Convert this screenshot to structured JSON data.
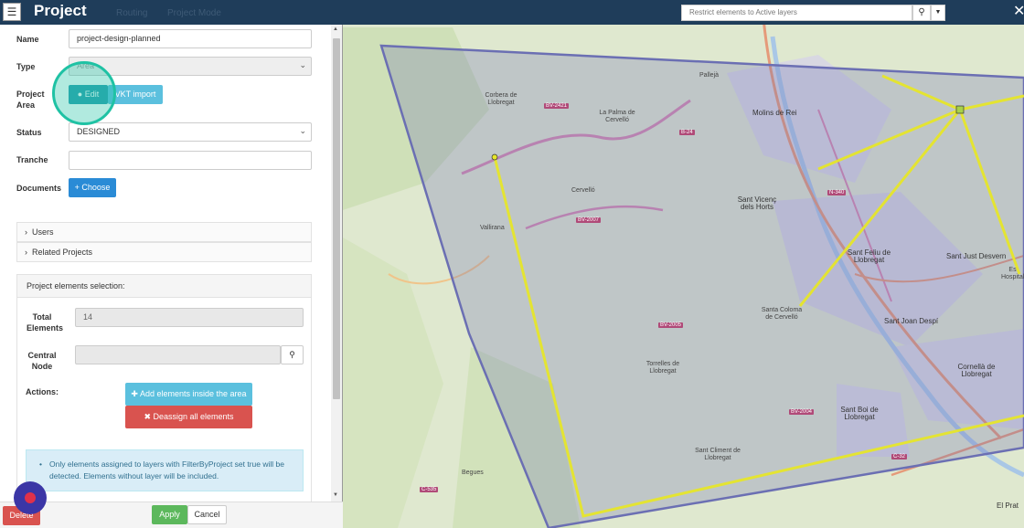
{
  "panel": {
    "title": "Project",
    "ghost_tabs": [
      "Routing",
      "Project Mode"
    ],
    "fields": {
      "name_label": "Name",
      "name_value": "project-design-planned",
      "type_label": "Type",
      "type_value": "Area",
      "area_label_1": "Project",
      "area_label_2": "Area",
      "edit_label": "Edit",
      "import_label": "VKT import",
      "status_label": "Status",
      "status_value": "DESIGNED",
      "tranche_label": "Tranche",
      "tranche_value": "",
      "documents_label": "Documents",
      "choose_label": "+ Choose"
    },
    "accordions": [
      "Users",
      "Related Projects"
    ],
    "selection": {
      "header": "Project elements selection:",
      "total_label_1": "Total",
      "total_label_2": "Elements",
      "total_value": "14",
      "central_label_1": "Central",
      "central_label_2": "Node",
      "central_value": "",
      "actions_label": "Actions:",
      "add_label": "Add elements inside the area",
      "deassign_label": "Deassign all elements",
      "info": "Only elements assigned to layers with FilterByProject set true will be detected. Elements without layer will be included."
    },
    "footer": {
      "delete_label": "Delete",
      "apply_label": "Apply",
      "cancel_label": "Cancel"
    }
  },
  "map": {
    "search_placeholder": "Restrict elements to Active layers",
    "labels": [
      {
        "text": "Pallejà"
      },
      {
        "text": "Molins de Rei"
      },
      {
        "text": "Corbera de Llobregat"
      },
      {
        "text": "La Palma de Cervelló"
      },
      {
        "text": "Cervelló"
      },
      {
        "text": "Vallirana"
      },
      {
        "text": "Sant Vicenç dels Horts"
      },
      {
        "text": "Sant Feliu de Llobregat"
      },
      {
        "text": "Sant Just Desvern"
      },
      {
        "text": "Santa Coloma de Cervelló"
      },
      {
        "text": "Sant Joan Despí"
      },
      {
        "text": "Torrelles de Llobregat"
      },
      {
        "text": "Cornellà de Llobregat"
      },
      {
        "text": "Sant Boi de Llobregat"
      },
      {
        "text": "Sant Climent de Llobregat"
      },
      {
        "text": "Begues"
      },
      {
        "text": "El Prat"
      },
      {
        "text": "Es Hospitalet"
      }
    ],
    "roads": [
      "BV-2421",
      "B-24",
      "N-340",
      "BV-2007",
      "BV-2005",
      "BV-2004",
      "C-32",
      "C-535"
    ]
  },
  "colors": {
    "header": "#1f3d5a",
    "primary": "#2a8bd6",
    "info_btn": "#5bc0de",
    "danger": "#d9534f",
    "success": "#5cb85c",
    "polygon": "#6b6fb3",
    "route": "#e6e62a"
  }
}
